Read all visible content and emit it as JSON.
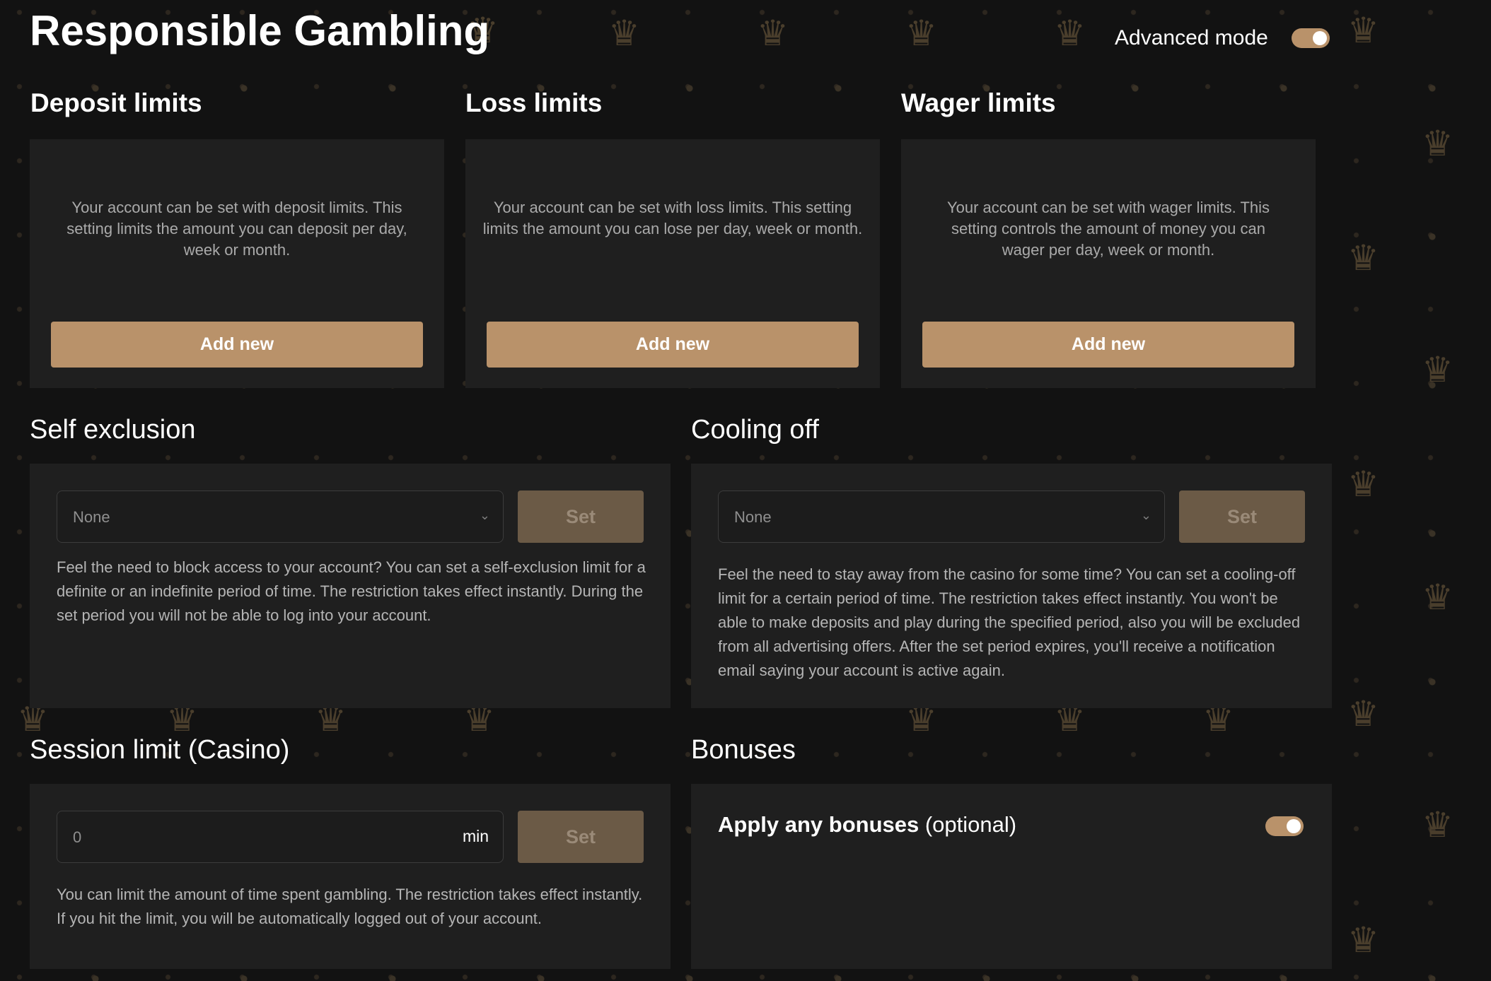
{
  "header": {
    "title": "Responsible Gambling",
    "advanced_mode_label": "Advanced mode",
    "advanced_mode_on": true
  },
  "limits": [
    {
      "title": "Deposit limits",
      "description": "Your account can be set with deposit limits. This setting limits the amount you can deposit per day, week or month.",
      "button": "Add new"
    },
    {
      "title": "Loss limits",
      "description": "Your account can be set with loss limits. This setting limits the amount you can lose per day, week or month.",
      "button": "Add new"
    },
    {
      "title": "Wager limits",
      "description": "Your account can be set with wager limits. This setting controls the amount of money you can wager per day, week or month.",
      "button": "Add new"
    }
  ],
  "self_exclusion": {
    "title": "Self exclusion",
    "select_value": "None",
    "button": "Set",
    "description": "Feel the need to block access to your account? You can set a self-exclusion limit for a definite or an indefinite period of time. The restriction takes effect instantly. During the set period you will not be able to log into your account."
  },
  "cooling_off": {
    "title": "Cooling off",
    "select_value": "None",
    "button": "Set",
    "description": "Feel the need to stay away from the casino for some time? You can set a cooling-off limit for a certain period of time. The restriction takes effect instantly. You won't be able to make deposits and play during the specified period, also you will be excluded from all advertising offers. After the set period expires, you'll receive a notification email saying your account is active again."
  },
  "session_limit": {
    "title": "Session limit (Casino)",
    "input_value": "0",
    "unit": "min",
    "button": "Set",
    "description": "You can limit the amount of time spent gambling. The restriction takes effect instantly. If you hit the limit, you will be automatically logged out of your account."
  },
  "bonuses": {
    "title": "Bonuses",
    "label_bold": "Apply any bonuses",
    "label_optional": "(optional)",
    "enabled": true
  },
  "colors": {
    "accent": "#b9926a",
    "background": "#121212",
    "card": "#1f1f1f",
    "set_button": "#6b5a46"
  }
}
